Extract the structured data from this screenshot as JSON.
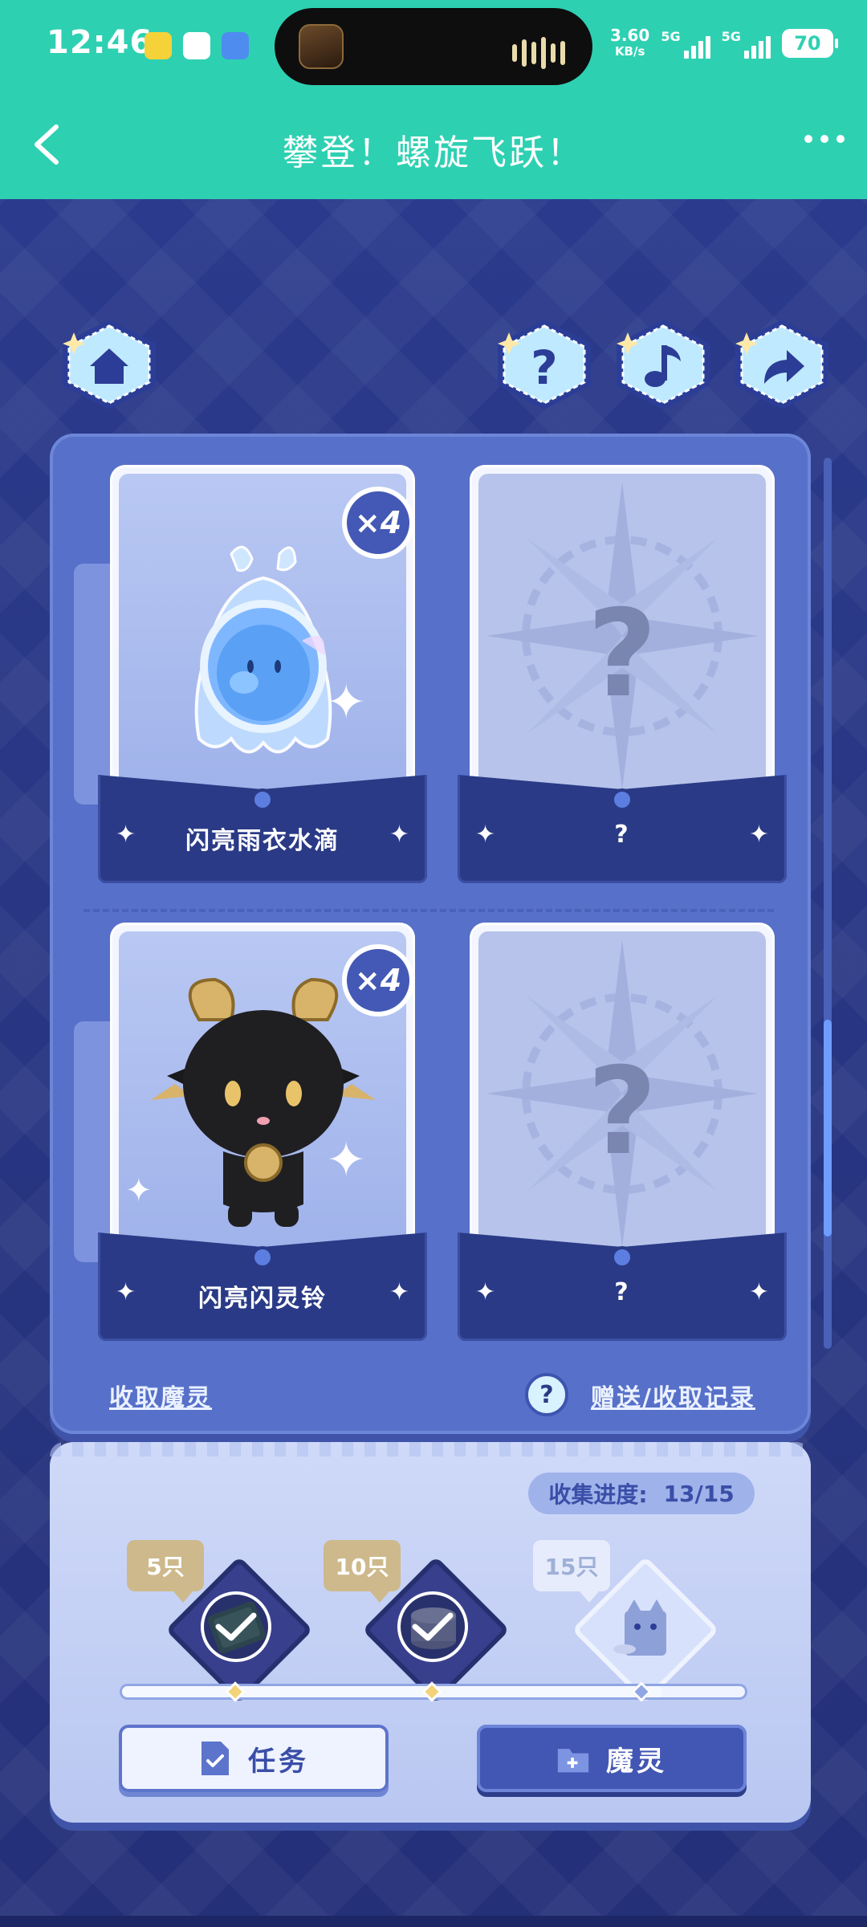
{
  "status_bar": {
    "time": "12:46",
    "speed_value": "3.60",
    "speed_unit": "KB/s",
    "network_1": "5G",
    "network_2": "5G",
    "battery": "70"
  },
  "header": {
    "title": "攀登！螺旋飞跃！"
  },
  "top_buttons": {
    "home_icon": "home-icon",
    "help_icon": "question-icon",
    "music_icon": "music-note-icon",
    "share_icon": "share-arrow-icon"
  },
  "cards": [
    {
      "name": "闪亮雨衣水滴",
      "count": "×4",
      "unlocked": true
    },
    {
      "name": "?",
      "count": "",
      "unlocked": false
    },
    {
      "name": "闪亮闪灵铃",
      "count": "×4",
      "unlocked": true
    },
    {
      "name": "?",
      "count": "",
      "unlocked": false
    }
  ],
  "panel_links": {
    "collect": "收取魔灵",
    "help": "?",
    "records": "赠送/收取记录"
  },
  "progress": {
    "label": "收集进度:",
    "value": "13/15",
    "collected": 13,
    "total": 15,
    "milestones": [
      {
        "label": "5只",
        "done": true
      },
      {
        "label": "10只",
        "done": true
      },
      {
        "label": "15只",
        "done": false
      }
    ]
  },
  "buttons": {
    "task": "任务",
    "spirit": "魔灵"
  },
  "colors": {
    "header": "#2ed0b2",
    "page_bg": "#26347e",
    "panel": "#5770c9",
    "accent": "#4256b3"
  }
}
